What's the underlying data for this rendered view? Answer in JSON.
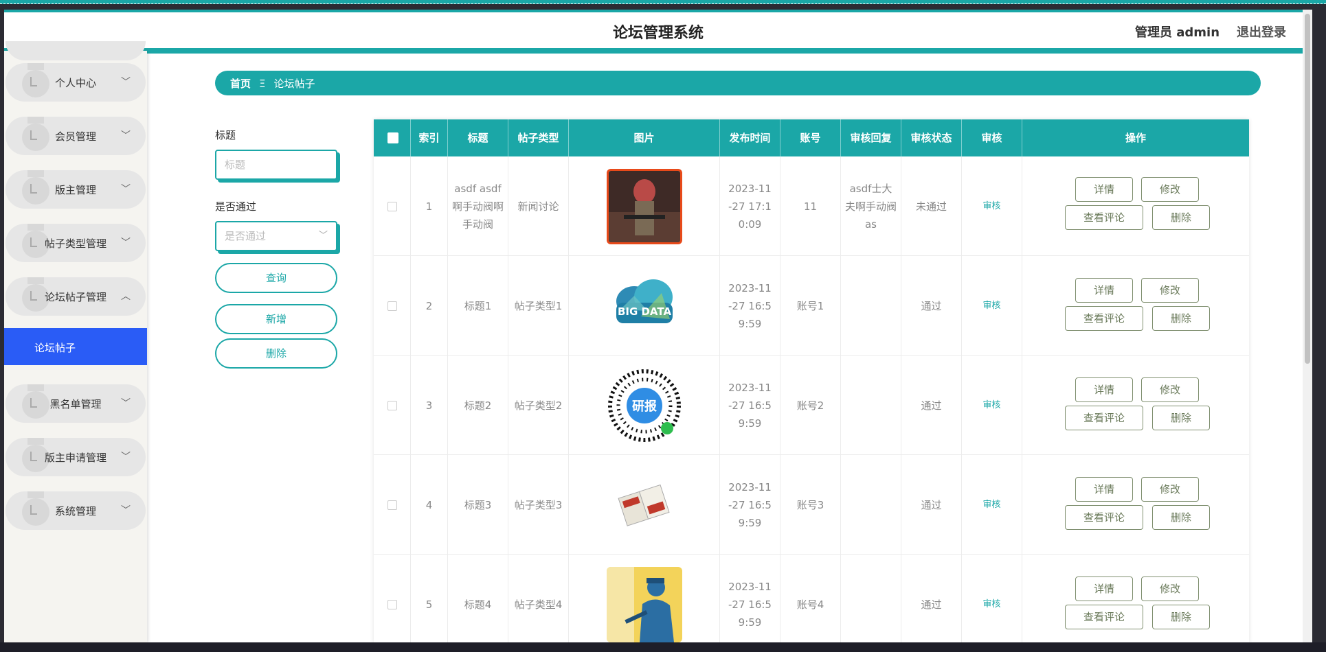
{
  "header": {
    "title": "论坛管理系统",
    "admin_label": "管理员 admin",
    "logout_label": "退出登录"
  },
  "sidebar": {
    "items": [
      {
        "label": "个人中心",
        "chevron": "﹀"
      },
      {
        "label": "会员管理",
        "chevron": "﹀"
      },
      {
        "label": "版主管理",
        "chevron": "﹀"
      },
      {
        "label": "帖子类型管理",
        "chevron": "﹀"
      },
      {
        "label": "论坛帖子管理",
        "chevron": "︿"
      },
      {
        "label": "黑名单管理",
        "chevron": "﹀"
      },
      {
        "label": "版主申请管理",
        "chevron": "﹀"
      },
      {
        "label": "系统管理",
        "chevron": "﹀"
      }
    ],
    "active_sub": "论坛帖子"
  },
  "breadcrumb": {
    "home": "首页",
    "separator": "Ξ",
    "current": "论坛帖子"
  },
  "filter": {
    "title_label": "标题",
    "title_placeholder": "标题",
    "pass_label": "是否通过",
    "pass_placeholder": "是否通过",
    "query_button": "查询",
    "add_button": "新增",
    "delete_button": "删除"
  },
  "table": {
    "headers": [
      "索引",
      "标题",
      "帖子类型",
      "图片",
      "发布时间",
      "账号",
      "审核回复",
      "审核状态",
      "审核",
      "操作"
    ],
    "rows": [
      {
        "index": "1",
        "title": "asdf asdf啊手动阀啊手动阀",
        "type": "新闻讨论",
        "image": "soldier-photo",
        "time": "2023-11-27 17:10:09",
        "account": "11",
        "reply": "asdf士大夫啊手动阀as",
        "status": "未通过",
        "audit": "审核"
      },
      {
        "index": "2",
        "title": "标题1",
        "type": "帖子类型1",
        "image": "big-data-cloud",
        "time": "2023-11-27 16:59:59",
        "account": "账号1",
        "reply": "",
        "status": "通过",
        "audit": "审核"
      },
      {
        "index": "3",
        "title": "标题2",
        "type": "帖子类型2",
        "image": "mini-program-code",
        "time": "2023-11-27 16:59:59",
        "account": "账号2",
        "reply": "",
        "status": "通过",
        "audit": "审核"
      },
      {
        "index": "4",
        "title": "标题3",
        "type": "帖子类型3",
        "image": "brochure",
        "time": "2023-11-27 16:59:59",
        "account": "账号3",
        "reply": "",
        "status": "通过",
        "audit": "审核"
      },
      {
        "index": "5",
        "title": "标题4",
        "type": "帖子类型4",
        "image": "worker-illustration",
        "time": "2023-11-27 16:59:59",
        "account": "账号4",
        "reply": "",
        "status": "通过",
        "audit": "审核"
      }
    ],
    "ops": {
      "detail": "详情",
      "edit": "修改",
      "comments": "查看评论",
      "delete": "删除"
    }
  },
  "colors": {
    "accent": "#1ba7a7",
    "active_nav": "#2a5cf6",
    "op_border": "#7f8f6f"
  },
  "image_badge_text": {
    "big_data": "BIG DATA",
    "qr_center": "研报"
  }
}
